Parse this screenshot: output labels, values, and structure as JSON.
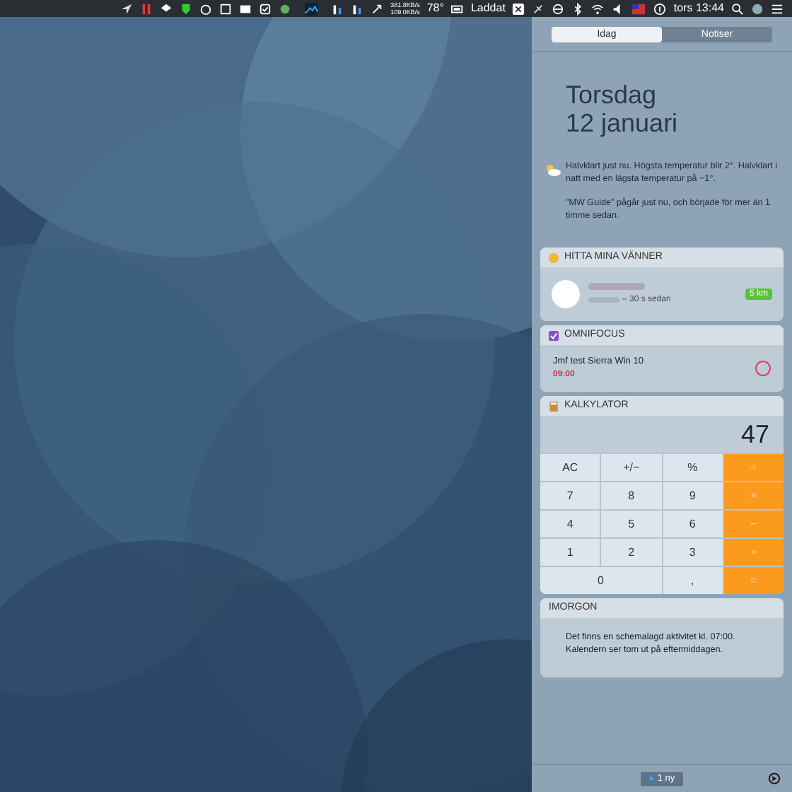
{
  "menu_bar": {
    "net_up": "381.8KB/s",
    "net_down": "109.0KB/s",
    "temperature": "78°",
    "battery_label": "Laddat",
    "clock": "tors 13:44"
  },
  "tabs": [
    {
      "label": "Idag",
      "selected": true
    },
    {
      "label": "Notiser",
      "selected": false
    }
  ],
  "date": {
    "weekday": "Torsdag",
    "day": "12 januari"
  },
  "summary": {
    "weather": "Halvklart just nu. Högsta temperatur blir 2°. Halvklart i natt med en lägsta temperatur på −1°.",
    "event": "\"MW Guide\" pågår just nu, och började för mer än 1 timme sedan."
  },
  "find_friends": {
    "title": "HITTA MINA VÄNNER",
    "time": "– 30 s sedan",
    "distance": "5 km"
  },
  "omnifocus": {
    "title": "OMNIFOCUS",
    "task": "Jmf test Sierra Win 10",
    "due": "09:00",
    "completed": false
  },
  "calculator": {
    "title": "KALKYLATOR",
    "display": "47",
    "keys": [
      {
        "label": "AC",
        "kind": "fn"
      },
      {
        "label": "+/−",
        "kind": "fn"
      },
      {
        "label": "%",
        "kind": "fn"
      },
      {
        "label": "÷",
        "kind": "op"
      },
      {
        "label": "7",
        "kind": "num"
      },
      {
        "label": "8",
        "kind": "num"
      },
      {
        "label": "9",
        "kind": "num"
      },
      {
        "label": "×",
        "kind": "op"
      },
      {
        "label": "4",
        "kind": "num"
      },
      {
        "label": "5",
        "kind": "num"
      },
      {
        "label": "6",
        "kind": "num"
      },
      {
        "label": "−",
        "kind": "op"
      },
      {
        "label": "1",
        "kind": "num"
      },
      {
        "label": "2",
        "kind": "num"
      },
      {
        "label": "3",
        "kind": "num"
      },
      {
        "label": "+",
        "kind": "op"
      },
      {
        "label": "0",
        "kind": "wide"
      },
      {
        "label": ",",
        "kind": "num"
      },
      {
        "label": "=",
        "kind": "op"
      }
    ]
  },
  "tomorrow": {
    "title": "IMORGON",
    "text": "Det finns en schemalagd aktivitet kl. 07:00. Kalendern ser tom ut på eftermiddagen."
  },
  "footer": {
    "new_count": "1 ny"
  }
}
